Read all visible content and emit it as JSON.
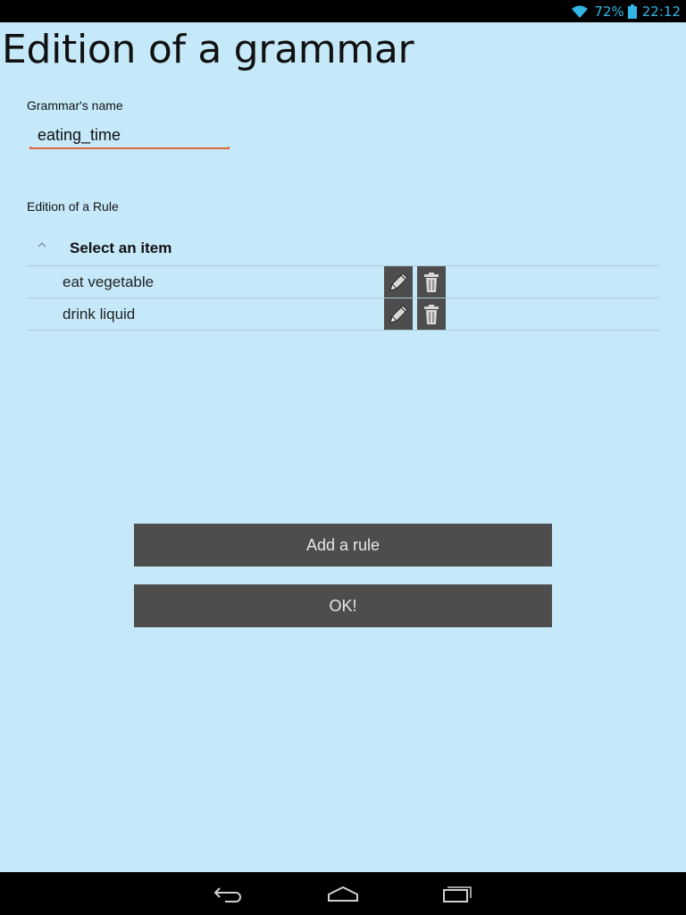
{
  "status_bar": {
    "battery_percent": "72%",
    "time": "22:12",
    "icons": [
      "wifi-icon",
      "battery-icon"
    ],
    "accent_color": "#33b5e5"
  },
  "page": {
    "title": "Edition of a grammar"
  },
  "grammar_name": {
    "label": "Grammar's name",
    "value": "eating_time",
    "underline_color": "#e0643a"
  },
  "rules_section": {
    "label": "Edition of a Rule",
    "header": "Select an item",
    "items": [
      {
        "label": "eat vegetable"
      },
      {
        "label": "drink liquid"
      }
    ]
  },
  "buttons": {
    "add_rule": "Add a rule",
    "ok": "OK!"
  },
  "nav_bar": {
    "icons": [
      "back-icon",
      "home-icon",
      "recent-apps-icon"
    ]
  },
  "colors": {
    "background": "#c6e9fa",
    "button": "#4d4d4d"
  }
}
